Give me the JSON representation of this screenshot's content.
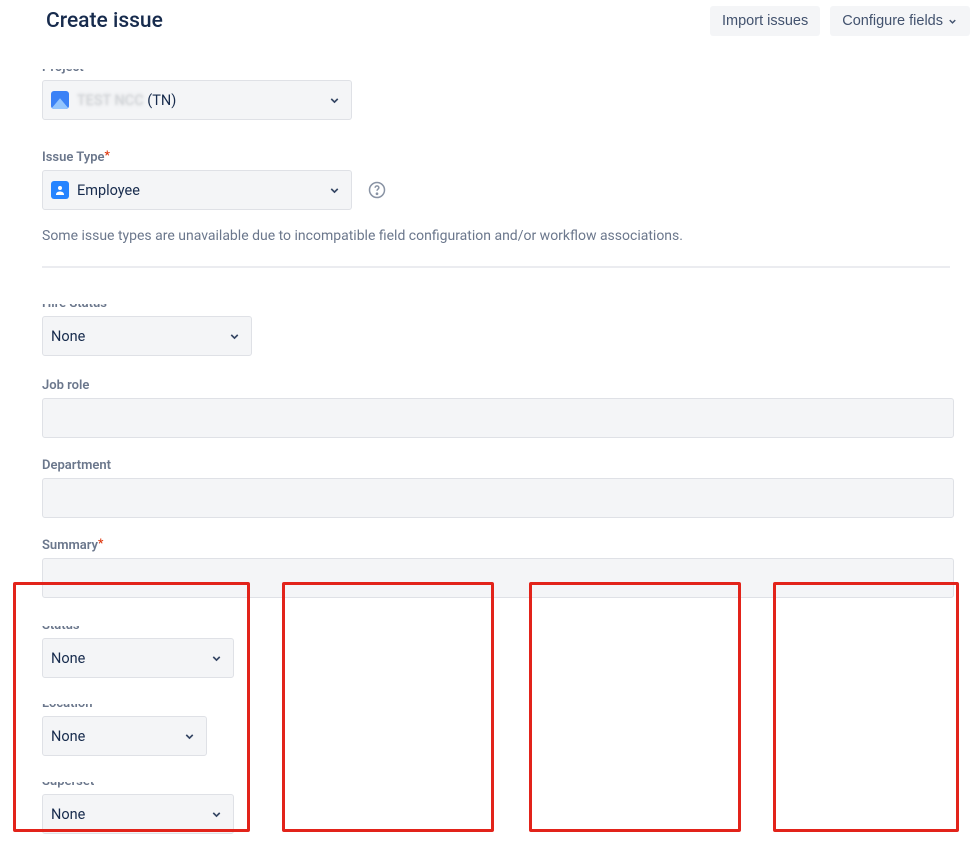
{
  "header": {
    "title": "Create issue",
    "import_label": "Import issues",
    "configure_label": "Configure fields"
  },
  "project": {
    "label": "Project",
    "value_obscured_prefix": "TEST NCC",
    "value_suffix": " (TN)"
  },
  "issue_type": {
    "label": "Issue Type",
    "value": "Employee",
    "hint": "Some issue types are unavailable due to incompatible field configuration and/or workflow associations."
  },
  "truncated_field_1": {
    "label": "Hire Status",
    "value": "None"
  },
  "job_role": {
    "label": "Job role",
    "value": ""
  },
  "department": {
    "label": "Department",
    "value": ""
  },
  "summary": {
    "label": "Summary",
    "value": ""
  },
  "boxed": {
    "field_a": {
      "label": "Status",
      "value": "None"
    },
    "field_b": {
      "label": "Location",
      "value": "None"
    },
    "field_c": {
      "label": "Superset",
      "value": "None"
    }
  }
}
